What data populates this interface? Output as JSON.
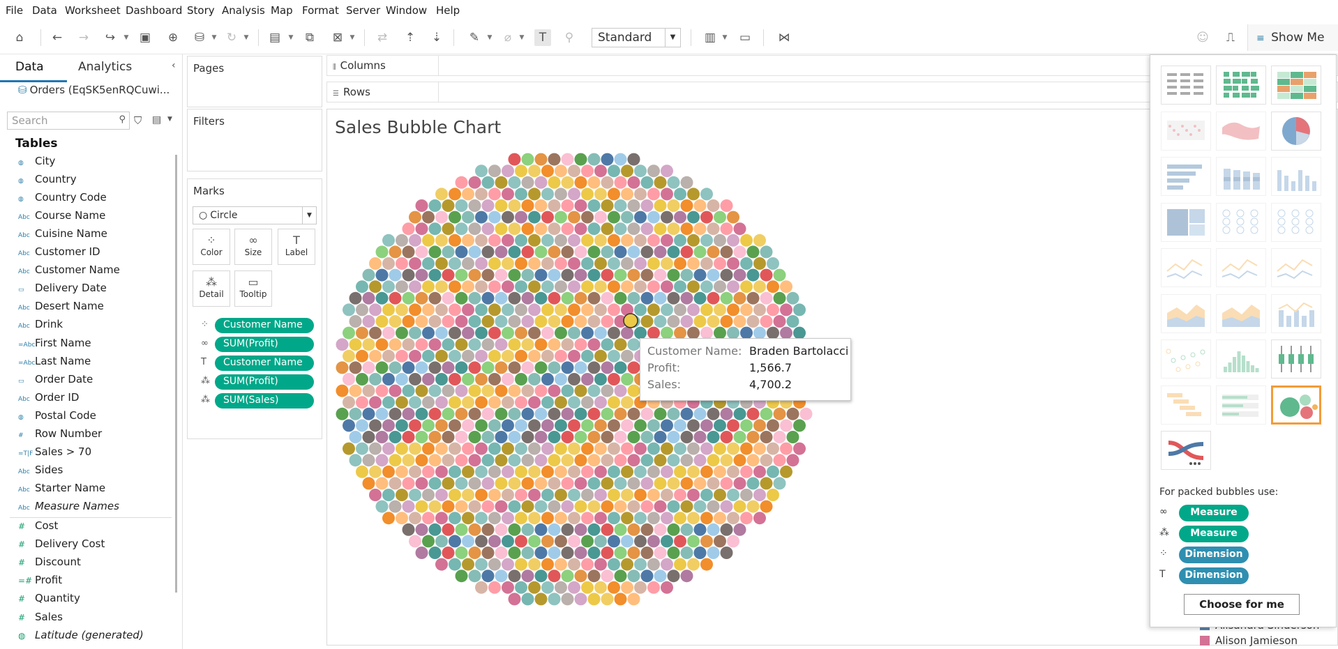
{
  "menu": [
    "File",
    "Data",
    "Worksheet",
    "Dashboard",
    "Story",
    "Analysis",
    "Map",
    "Format",
    "Server",
    "Window",
    "Help"
  ],
  "toolbar": {
    "fit_mode": "Standard",
    "show_me_label": "Show Me"
  },
  "data_pane": {
    "tab_data": "Data",
    "tab_analytics": "Analytics",
    "datasource": "Orders (EqSK5enRQCuwi...",
    "search_placeholder": "Search",
    "tables_heading": "Tables",
    "dimensions": [
      {
        "icon": "globe-icon",
        "glyph": "◍",
        "name": "City"
      },
      {
        "icon": "globe-icon",
        "glyph": "◍",
        "name": "Country"
      },
      {
        "icon": "globe-icon",
        "glyph": "◍",
        "name": "Country Code"
      },
      {
        "icon": "abc-icon",
        "glyph": "Abc",
        "name": "Course Name"
      },
      {
        "icon": "abc-icon",
        "glyph": "Abc",
        "name": "Cuisine Name"
      },
      {
        "icon": "abc-icon",
        "glyph": "Abc",
        "name": "Customer ID"
      },
      {
        "icon": "abc-icon",
        "glyph": "Abc",
        "name": "Customer Name"
      },
      {
        "icon": "calendar-icon",
        "glyph": "▭",
        "name": "Delivery Date"
      },
      {
        "icon": "abc-icon",
        "glyph": "Abc",
        "name": "Desert Name"
      },
      {
        "icon": "abc-icon",
        "glyph": "Abc",
        "name": "Drink"
      },
      {
        "icon": "calc-abc-icon",
        "glyph": "=Abc",
        "name": "First Name"
      },
      {
        "icon": "calc-abc-icon",
        "glyph": "=Abc",
        "name": "Last Name"
      },
      {
        "icon": "calendar-icon",
        "glyph": "▭",
        "name": "Order Date"
      },
      {
        "icon": "abc-icon",
        "glyph": "Abc",
        "name": "Order ID"
      },
      {
        "icon": "globe-icon",
        "glyph": "◍",
        "name": "Postal Code"
      },
      {
        "icon": "number-icon",
        "glyph": "#",
        "name": "Row Number"
      },
      {
        "icon": "calc-bool-icon",
        "glyph": "=T|F",
        "name": "Sales > 70"
      },
      {
        "icon": "abc-icon",
        "glyph": "Abc",
        "name": "Sides"
      },
      {
        "icon": "abc-icon",
        "glyph": "Abc",
        "name": "Starter Name"
      },
      {
        "icon": "abc-icon",
        "glyph": "Abc",
        "name": "Measure Names"
      }
    ],
    "measures": [
      {
        "icon": "number-icon",
        "glyph": "#",
        "name": "Cost"
      },
      {
        "icon": "number-icon",
        "glyph": "#",
        "name": "Delivery Cost"
      },
      {
        "icon": "number-icon",
        "glyph": "#",
        "name": "Discount"
      },
      {
        "icon": "calc-number-icon",
        "glyph": "=#",
        "name": "Profit"
      },
      {
        "icon": "number-icon",
        "glyph": "#",
        "name": "Quantity"
      },
      {
        "icon": "number-icon",
        "glyph": "#",
        "name": "Sales"
      },
      {
        "icon": "globe-icon",
        "glyph": "◍",
        "name": "Latitude (generated)"
      }
    ]
  },
  "cards": {
    "pages": "Pages",
    "filters": "Filters",
    "marks": "Marks",
    "mark_type": "Circle",
    "mark_buttons": [
      {
        "icon": "color-icon",
        "glyph": "⁘",
        "label": "Color"
      },
      {
        "icon": "size-icon",
        "glyph": "∞",
        "label": "Size"
      },
      {
        "icon": "label-icon",
        "glyph": "T",
        "label": "Label"
      },
      {
        "icon": "detail-icon",
        "glyph": "⁂",
        "label": "Detail"
      },
      {
        "icon": "tooltip-icon",
        "glyph": "▭",
        "label": "Tooltip"
      }
    ],
    "mark_pills": [
      {
        "icon": "color-icon",
        "glyph": "⁘",
        "label": "Customer Name",
        "kind": "measure"
      },
      {
        "icon": "size-icon",
        "glyph": "∞",
        "label": "SUM(Profit)",
        "kind": "measure"
      },
      {
        "icon": "label-icon",
        "glyph": "T",
        "label": "Customer Name",
        "kind": "measure"
      },
      {
        "icon": "detail-icon",
        "glyph": "⁂",
        "label": "SUM(Profit)",
        "kind": "measure"
      },
      {
        "icon": "detail-icon",
        "glyph": "⁂",
        "label": "SUM(Sales)",
        "kind": "measure"
      }
    ]
  },
  "shelves": {
    "columns": "Columns",
    "rows": "Rows"
  },
  "view": {
    "title": "Sales Bubble Chart",
    "palette": [
      "#4e79a7",
      "#f28e2b",
      "#e15759",
      "#76b7b2",
      "#59a14f",
      "#edc948",
      "#b07aa1",
      "#ff9da7",
      "#9c755f",
      "#bab0ac",
      "#a0cbe8",
      "#ffbe7d",
      "#8cd17d",
      "#b6992d",
      "#86bcb6",
      "#f1ce63",
      "#499894",
      "#d37295",
      "#fabfd2",
      "#d4a6c8",
      "#79706e",
      "#d7b5a6",
      "#e49444",
      "#8ec3c0"
    ]
  },
  "tooltip": {
    "rows": [
      {
        "key": "Customer Name:",
        "value": "Braden Bartolacci"
      },
      {
        "key": "Profit:",
        "value": "1,566.7"
      },
      {
        "key": "Sales:",
        "value": "4,700.2"
      }
    ]
  },
  "legend": [
    {
      "label": "Alisandra Sinderson",
      "color": "#5b7fa8"
    },
    {
      "label": "Alison Jamieson",
      "color": "#d37295"
    }
  ],
  "show_me": {
    "charts": [
      "text-table",
      "heat-map",
      "highlight-table",
      "symbol-map",
      "filled-map",
      "pie-chart",
      "horizontal-bars",
      "stacked-bars",
      "side-by-side-bars",
      "treemap",
      "circle-views",
      "side-by-side-circles",
      "continuous-lines",
      "discrete-lines",
      "dual-lines",
      "area-continuous",
      "area-discrete",
      "dual-combination",
      "scatter-plot",
      "histogram",
      "box-and-whisker",
      "gantt-chart",
      "bullet-graph",
      "packed-bubbles",
      "sankey-extension"
    ],
    "selected": "packed-bubbles",
    "hint": "For packed bubbles use:",
    "requirements": [
      {
        "icon": "size-icon",
        "glyph": "∞",
        "label": "Measure",
        "kind": "m"
      },
      {
        "icon": "detail-icon",
        "glyph": "⁂",
        "label": "Measure",
        "kind": "m"
      },
      {
        "icon": "color-icon",
        "glyph": "⁘",
        "label": "Dimension",
        "kind": "d"
      },
      {
        "icon": "label-icon",
        "glyph": "T",
        "label": "Dimension",
        "kind": "d"
      }
    ],
    "choose_label": "Choose for me"
  }
}
